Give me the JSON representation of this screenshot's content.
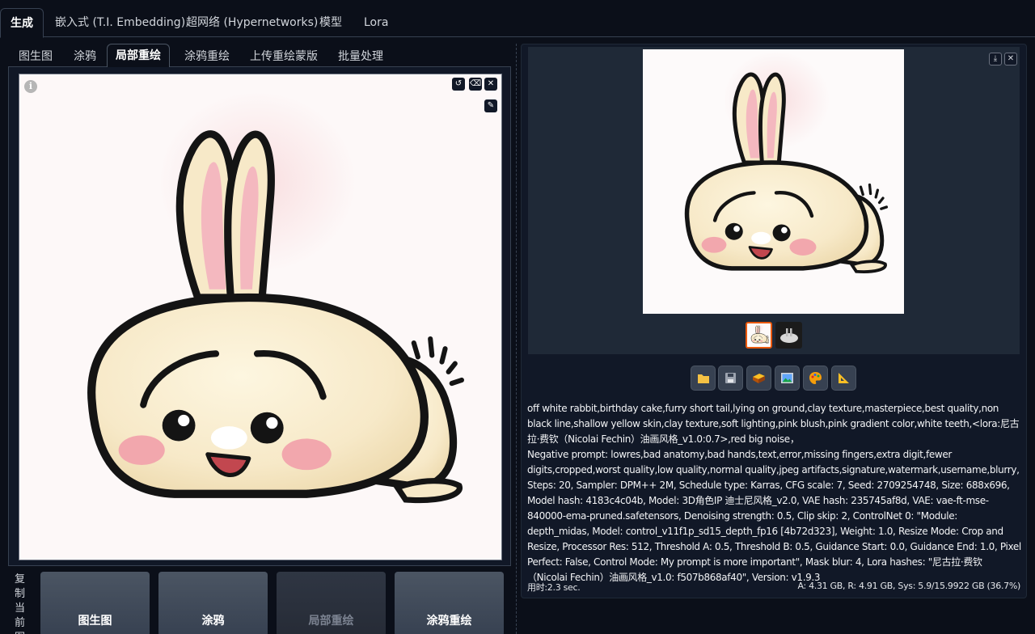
{
  "top_tabs": [
    "生成",
    "嵌入式 (T.I. Embedding)",
    "超网络 (Hypernetworks)",
    "模型",
    "Lora"
  ],
  "sub_tabs": [
    "图生图",
    "涂鸦",
    "局部重绘",
    "涂鸦重绘",
    "上传重绘蒙版",
    "批量处理"
  ],
  "canvas": {
    "info_icon": "info-icon",
    "controls": [
      "undo-icon",
      "clear-icon",
      "close-icon",
      "brush-icon"
    ]
  },
  "copy_section": {
    "label": "复制当前图",
    "buttons": [
      "图生图",
      "涂鸦",
      "局部重绘",
      "涂鸦重绘"
    ]
  },
  "gallery": {
    "controls": [
      "download-icon",
      "close-icon"
    ],
    "thumbnails": 2
  },
  "toolbar": [
    "folder-icon",
    "save-icon",
    "zip-icon",
    "image-icon",
    "palette-icon",
    "ruler-icon"
  ],
  "generation_info": {
    "prompt": "off white rabbit,birthday cake,furry short tail,lying on ground,clay texture,masterpiece,best quality,non black line,shallow yellow skin,clay texture,soft lighting,pink blush,pink gradient color,white teeth,<lora:尼古拉·费钦（Nicolai Fechin）油画风格_v1.0:0.7>,red big noise，",
    "negative": "Negative prompt: lowres,bad anatomy,bad hands,text,error,missing fingers,extra digit,fewer digits,cropped,worst quality,low quality,normal quality,jpeg artifacts,signature,watermark,username,blurry,",
    "params": "Steps: 20, Sampler: DPM++ 2M, Schedule type: Karras, CFG scale: 7, Seed: 2709254748, Size: 688x696, Model hash: 4183c4c04b, Model: 3D角色IP 迪士尼风格_v2.0, VAE hash: 235745af8d, VAE: vae-ft-mse-840000-ema-pruned.safetensors, Denoising strength: 0.5, Clip skip: 2, ControlNet 0: \"Module: depth_midas, Model: control_v11f1p_sd15_depth_fp16 [4b72d323], Weight: 1.0, Resize Mode: Crop and Resize, Processor Res: 512, Threshold A: 0.5, Threshold B: 0.5, Guidance Start: 0.0, Guidance End: 1.0, Pixel Perfect: False, Control Mode: My prompt is more important\", Mask blur: 4, Lora hashes: \"尼古拉·费钦（Nicolai Fechin）油画风格_v1.0: f507b868af40\", Version: v1.9.3"
  },
  "footer": {
    "time": "用时:2.3 sec.",
    "memory": "A: 4.31 GB, R: 4.91 GB, Sys: 5.9/15.9922 GB (36.7%)"
  },
  "colors": {
    "background": "#0b0f19",
    "panel": "#111827",
    "accent": "#ea580c"
  }
}
